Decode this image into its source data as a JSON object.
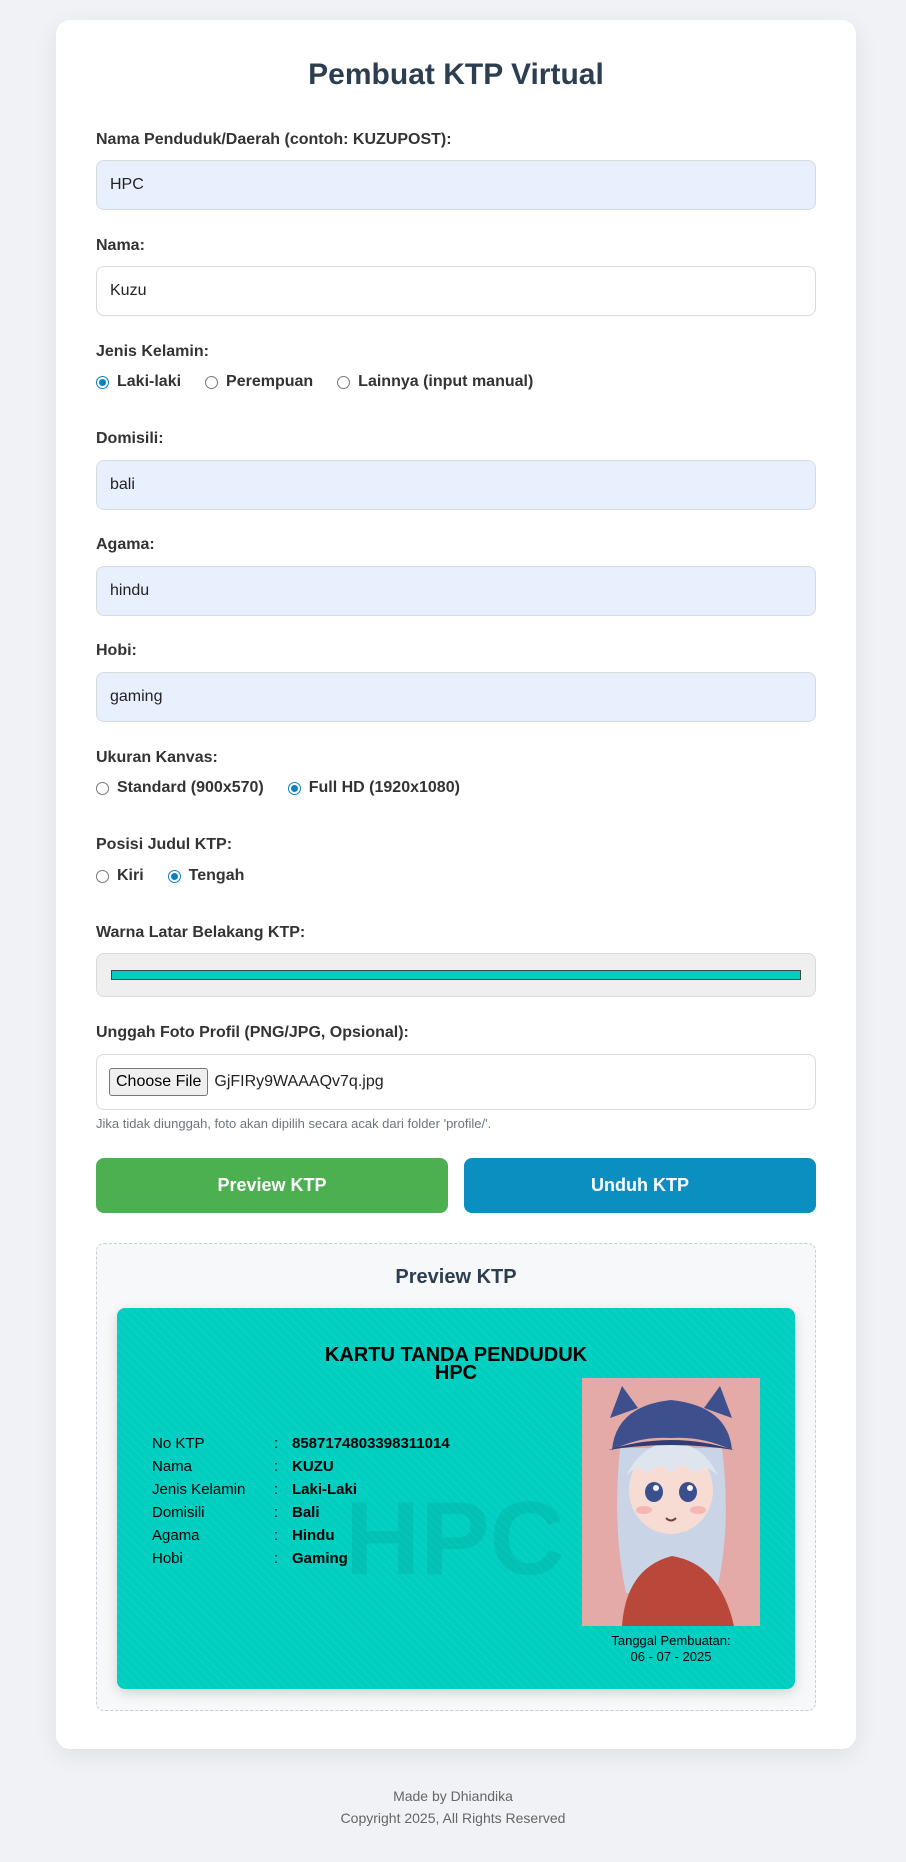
{
  "title": "Pembuat KTP Virtual",
  "form": {
    "region": {
      "label": "Nama Penduduk/Daerah (contoh: KUZUPOST):",
      "value": "HPC"
    },
    "name": {
      "label": "Nama:",
      "value": "Kuzu"
    },
    "gender": {
      "label": "Jenis Kelamin:",
      "options": [
        "Laki-laki",
        "Perempuan",
        "Lainnya (input manual)"
      ],
      "selected": "Laki-laki"
    },
    "domicile": {
      "label": "Domisili:",
      "value": "bali"
    },
    "religion": {
      "label": "Agama:",
      "value": "hindu"
    },
    "hobby": {
      "label": "Hobi:",
      "value": "gaming"
    },
    "canvas": {
      "label": "Ukuran Kanvas:",
      "options": [
        "Standard (900x570)",
        "Full HD (1920x1080)"
      ],
      "selected": "Full HD (1920x1080)"
    },
    "title_position": {
      "label": "Posisi Judul KTP:",
      "options": [
        "Kiri",
        "Tengah"
      ],
      "selected": "Tengah"
    },
    "bg_color": {
      "label": "Warna Latar Belakang KTP:",
      "value": "#00cec0"
    },
    "photo_upload": {
      "label": "Unggah Foto Profil (PNG/JPG, Opsional):",
      "button": "Choose File",
      "filename": "GjFIRy9WAAAQv7q.jpg",
      "hint": "Jika tidak diunggah, foto akan dipilih secara acak dari folder 'profile/'."
    }
  },
  "buttons": {
    "preview": {
      "label": "Preview KTP",
      "color": "#4caf50"
    },
    "download": {
      "label": "Unduh KTP",
      "color": "#0b8fc0"
    }
  },
  "preview": {
    "title": "Preview KTP",
    "card": {
      "heading": "KARTU TANDA PENDUDUK",
      "subheading": "HPC",
      "watermark": "HPC",
      "rows": [
        {
          "key": "No KTP",
          "sep": ":",
          "value": "8587174803398311014"
        },
        {
          "key": "Nama",
          "sep": ":",
          "value": "KUZU"
        },
        {
          "key": "Jenis Kelamin",
          "sep": ":",
          "value": "Laki-Laki"
        },
        {
          "key": "Domisili",
          "sep": ":",
          "value": "Bali"
        },
        {
          "key": "Agama",
          "sep": ":",
          "value": "Hindu"
        },
        {
          "key": "Hobi",
          "sep": ":",
          "value": "Gaming"
        }
      ],
      "date_label": "Tanggal Pembuatan:",
      "date_value": "06 - 07 - 2025"
    }
  },
  "footer": {
    "line1": "Made by Dhiandika",
    "line2": "Copyright 2025, All Rights Reserved"
  }
}
